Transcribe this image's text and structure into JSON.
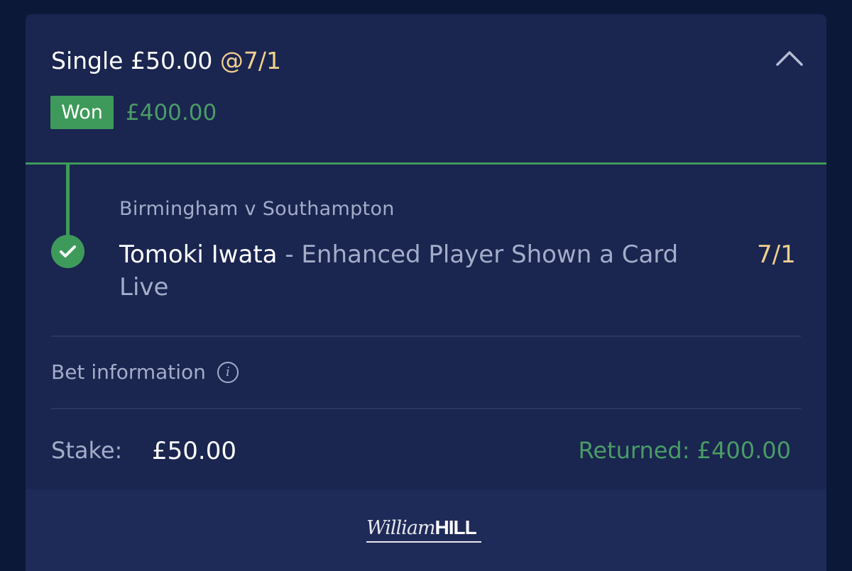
{
  "bet": {
    "type_label": "Single",
    "stake_header": "£50.00",
    "odds_header": "@7/1",
    "status": "Won",
    "payout": "£400.00"
  },
  "selection": {
    "event": "Birmingham v Southampton",
    "player": "Tomoki Iwata",
    "separator": "-",
    "market": "Enhanced Player Shown a Card Live",
    "odds": "7/1"
  },
  "bet_information": {
    "label": "Bet information",
    "icon": "info-icon"
  },
  "summary": {
    "stake_label": "Stake:",
    "stake_value": "£50.00",
    "returned": "Returned: £400.00"
  },
  "footer": {
    "logo_script": "William",
    "logo_bold": "HILL"
  },
  "colors": {
    "background": "#0c1838",
    "card": "#1a2550",
    "accent_green": "#3e9a5a",
    "odds_gold": "#f2cf8e",
    "muted_text": "#a3adc8"
  }
}
